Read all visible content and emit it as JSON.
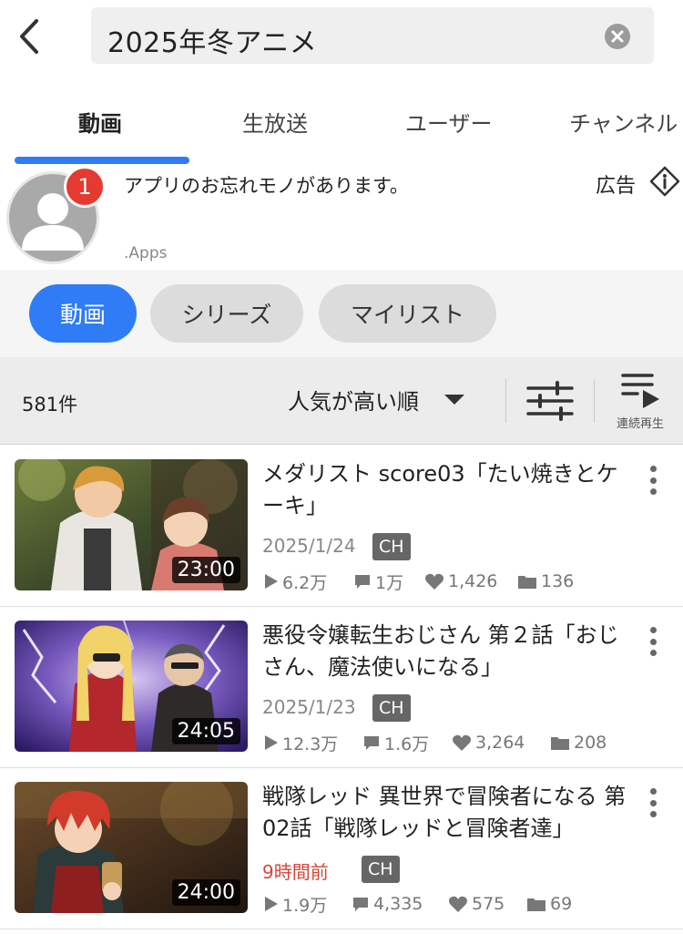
{
  "header": {
    "search_value": "2025年冬アニメ"
  },
  "tabs": [
    {
      "label": "動画",
      "active": true
    },
    {
      "label": "生放送",
      "active": false
    },
    {
      "label": "ユーザー",
      "active": false
    },
    {
      "label": "チャンネル",
      "active": false
    }
  ],
  "ad": {
    "badge_count": "1",
    "title": "アプリのお忘れモノがあります。",
    "source": ".Apps",
    "label": "広告"
  },
  "chips": [
    {
      "label": "動画",
      "active": true
    },
    {
      "label": "シリーズ",
      "active": false
    },
    {
      "label": "マイリスト",
      "active": false
    }
  ],
  "sortbar": {
    "count": "581件",
    "sort_label": "人気が高い順",
    "continuous_label": "連続再生"
  },
  "colors": {
    "accent": "#2f7cf6",
    "badge_red": "#e6392f",
    "recent_date": "#d6463c"
  },
  "videos": [
    {
      "title": "メダリスト score03「たい焼きとケーキ」",
      "duration": "23:00",
      "date": "2025/1/24",
      "date_recent": false,
      "badge": "CH",
      "views": "6.2万",
      "comments": "1万",
      "likes": "1,426",
      "mylists": "136"
    },
    {
      "title": "悪役令嬢転生おじさん 第２話「おじさん、魔法使いになる」",
      "duration": "24:05",
      "date": "2025/1/23",
      "date_recent": false,
      "badge": "CH",
      "views": "12.3万",
      "comments": "1.6万",
      "likes": "3,264",
      "mylists": "208"
    },
    {
      "title": "戦隊レッド 異世界で冒険者になる 第02話「戦隊レッドと冒険者達」",
      "duration": "24:00",
      "date": "9時間前",
      "date_recent": true,
      "badge": "CH",
      "views": "1.9万",
      "comments": "4,335",
      "likes": "575",
      "mylists": "69"
    }
  ]
}
